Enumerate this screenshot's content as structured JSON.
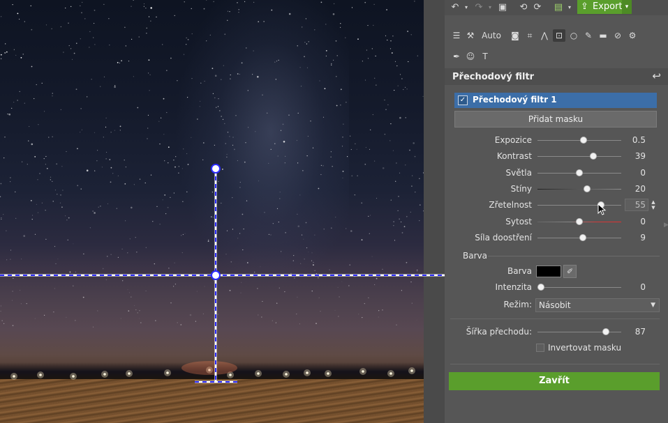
{
  "canvas": {
    "description_icon": "night-sky-photo"
  },
  "toolbar": {
    "icons": [
      "undo-icon",
      "undo-dropdown-icon",
      "redo-icon",
      "redo-dropdown-icon",
      "image-icon",
      "rotate-left-icon",
      "rotate-right-icon",
      "save-icon",
      "save-dropdown-icon",
      "export-icon"
    ],
    "export_label": "Export"
  },
  "tools": {
    "auto_label": "Auto",
    "row1": [
      "sliders-icon",
      "wand-icon",
      "camera-icon",
      "crop-icon",
      "perspective-icon",
      "gradient-filter-icon",
      "circle-icon",
      "brush-icon",
      "eraser-icon",
      "bandage-icon",
      "gear-icon"
    ],
    "row2": [
      "pen-icon",
      "mask-icon",
      "text-icon"
    ]
  },
  "section": {
    "title": "Přechodový filtr"
  },
  "filter": {
    "name": "Přechodový filtr 1",
    "checked": true
  },
  "mask_button": "Přidat masku",
  "sliders": [
    {
      "label": "Expozice",
      "value": "0.5",
      "position": 0.55
    },
    {
      "label": "Kontrast",
      "value": "39",
      "position": 0.67
    },
    {
      "label": "Světla",
      "value": "0",
      "position": 0.5
    },
    {
      "label": "Stíny",
      "value": "20",
      "position": 0.59
    },
    {
      "label": "Zřetelnost",
      "value": "55",
      "position": 0.76
    },
    {
      "label": "Sytost",
      "value": "0",
      "position": 0.5
    },
    {
      "label": "Síla doostření",
      "value": "9",
      "position": 0.54
    }
  ],
  "color_section": {
    "heading": "Barva",
    "color_label": "Barva",
    "color_value": "#000000",
    "intensity_label": "Intenzita",
    "intensity_value": "0",
    "intensity_position": 0.04,
    "mode_label": "Režim:",
    "mode_value": "Násobit"
  },
  "transition": {
    "label": "Šířka přechodu:",
    "value": "87",
    "position": 0.82
  },
  "invert": {
    "label": "Invertovat masku",
    "checked": false
  },
  "close_button": "Zavřít",
  "colors": {
    "accent_green": "#5a9e2c",
    "selection_blue": "#3c6ea8",
    "guide_blue": "#2a2aff"
  }
}
